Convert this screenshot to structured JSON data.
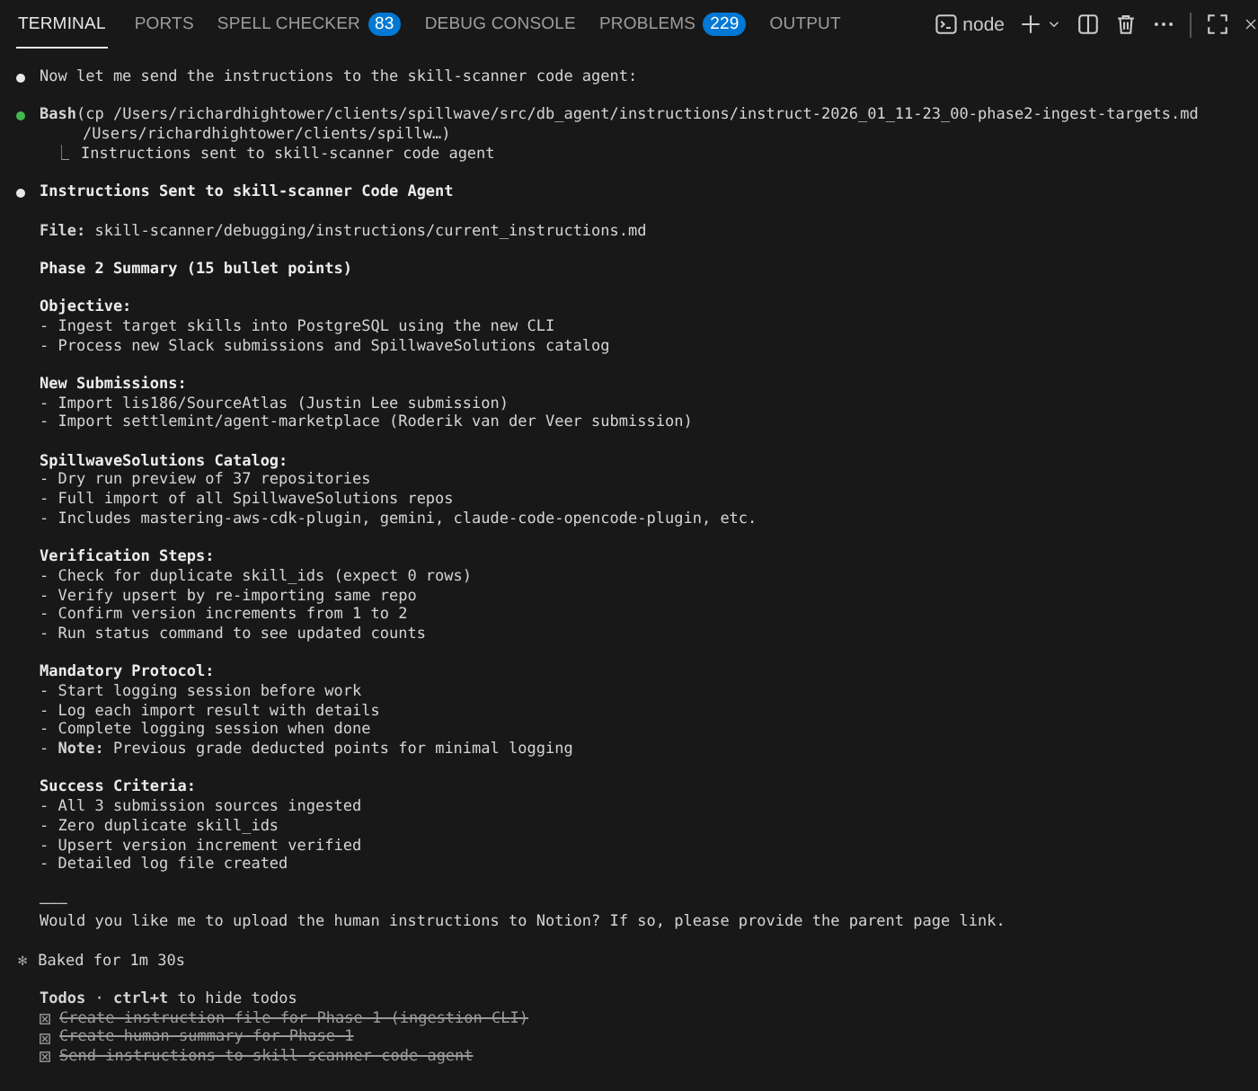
{
  "tabs": [
    {
      "label": "TERMINAL",
      "selected": true
    },
    {
      "label": "PORTS",
      "selected": false
    },
    {
      "label": "SPELL CHECKER",
      "badge": "83",
      "selected": false
    },
    {
      "label": "DEBUG CONSOLE",
      "selected": false
    },
    {
      "label": "PROBLEMS",
      "badge": "229",
      "selected": false
    },
    {
      "label": "OUTPUT",
      "selected": false
    }
  ],
  "toolbar": {
    "profile": "node"
  },
  "blocks": [
    [
      {
        "kind": "bullet",
        "color": "#e8e8e8",
        "text": "Now let me send the instructions to the skill-scanner code agent:"
      }
    ],
    [
      {
        "kind": "bullet",
        "color": "#3fb950",
        "text": "**Bash**(cp /Users/richardhightower/clients/spillwave/src/db_agent/instructions/instruct-2026_01_11-23_00-phase2-ingest-targets.md"
      },
      {
        "kind": "continuation",
        "text": "/Users/richardhightower/clients/spillw…)"
      },
      {
        "kind": "result",
        "glyph": "⎿",
        "text": "Instructions sent to skill-scanner code agent"
      }
    ],
    [
      {
        "kind": "bullet",
        "color": "#e8e8e8",
        "bold": true,
        "text": "Instructions Sent to skill-scanner Code Agent"
      }
    ],
    [
      {
        "kind": "plain",
        "text": "**File:** skill-scanner/debugging/instructions/current_instructions.md"
      }
    ],
    [
      {
        "kind": "plain",
        "bold": true,
        "text": "Phase 2 Summary (15 bullet points)"
      }
    ],
    [
      {
        "kind": "plain",
        "bold": true,
        "text": "Objective:"
      },
      {
        "kind": "plain",
        "text": "- Ingest target skills into PostgreSQL using the new CLI"
      },
      {
        "kind": "plain",
        "text": "- Process new Slack submissions and SpillwaveSolutions catalog"
      }
    ],
    [
      {
        "kind": "plain",
        "bold": true,
        "text": "New Submissions:"
      },
      {
        "kind": "plain",
        "text": "- Import lis186/SourceAtlas (Justin Lee submission)"
      },
      {
        "kind": "plain",
        "text": "- Import settlemint/agent-marketplace (Roderik van der Veer submission)"
      }
    ],
    [
      {
        "kind": "plain",
        "bold": true,
        "text": "SpillwaveSolutions Catalog:"
      },
      {
        "kind": "plain",
        "text": "- Dry run preview of 37 repositories"
      },
      {
        "kind": "plain",
        "text": "- Full import of all SpillwaveSolutions repos"
      },
      {
        "kind": "plain",
        "text": "- Includes mastering-aws-cdk-plugin, gemini, claude-code-opencode-plugin, etc."
      }
    ],
    [
      {
        "kind": "plain",
        "bold": true,
        "text": "Verification Steps:"
      },
      {
        "kind": "plain",
        "text": "- Check for duplicate skill_ids (expect 0 rows)"
      },
      {
        "kind": "plain",
        "text": "- Verify upsert by re-importing same repo"
      },
      {
        "kind": "plain",
        "text": "- Confirm version increments from 1 to 2"
      },
      {
        "kind": "plain",
        "text": "- Run status command to see updated counts"
      }
    ],
    [
      {
        "kind": "plain",
        "bold": true,
        "text": "Mandatory Protocol:"
      },
      {
        "kind": "plain",
        "text": "- Start logging session before work"
      },
      {
        "kind": "plain",
        "text": "- Log each import result with details"
      },
      {
        "kind": "plain",
        "text": "- Complete logging session when done"
      },
      {
        "kind": "plain",
        "text": "- **Note:** Previous grade deducted points for minimal logging"
      }
    ],
    [
      {
        "kind": "plain",
        "bold": true,
        "text": "Success Criteria:"
      },
      {
        "kind": "plain",
        "text": "- All 3 submission sources ingested"
      },
      {
        "kind": "plain",
        "text": "- Zero duplicate skill_ids"
      },
      {
        "kind": "plain",
        "text": "- Upsert version increment verified"
      },
      {
        "kind": "plain",
        "text": "- Detailed log file created"
      }
    ],
    [
      {
        "kind": "plain",
        "text": "———"
      },
      {
        "kind": "plain",
        "text": "Would you like me to upload the human instructions to Notion? If so, please provide the parent page link."
      }
    ],
    [
      {
        "kind": "status",
        "glyph": "✻",
        "text": "Baked for 1m 30s"
      }
    ],
    [
      {
        "kind": "plain",
        "text": "**Todos** · **ctrl+t** to hide todos"
      },
      {
        "kind": "todo",
        "checked": true,
        "text": "Create instruction file for Phase 1 (ingestion CLI)"
      },
      {
        "kind": "todo",
        "checked": true,
        "text": "Create human summary for Phase 1"
      },
      {
        "kind": "todo",
        "checked": true,
        "text": "Send instructions to skill-scanner code agent"
      }
    ]
  ]
}
